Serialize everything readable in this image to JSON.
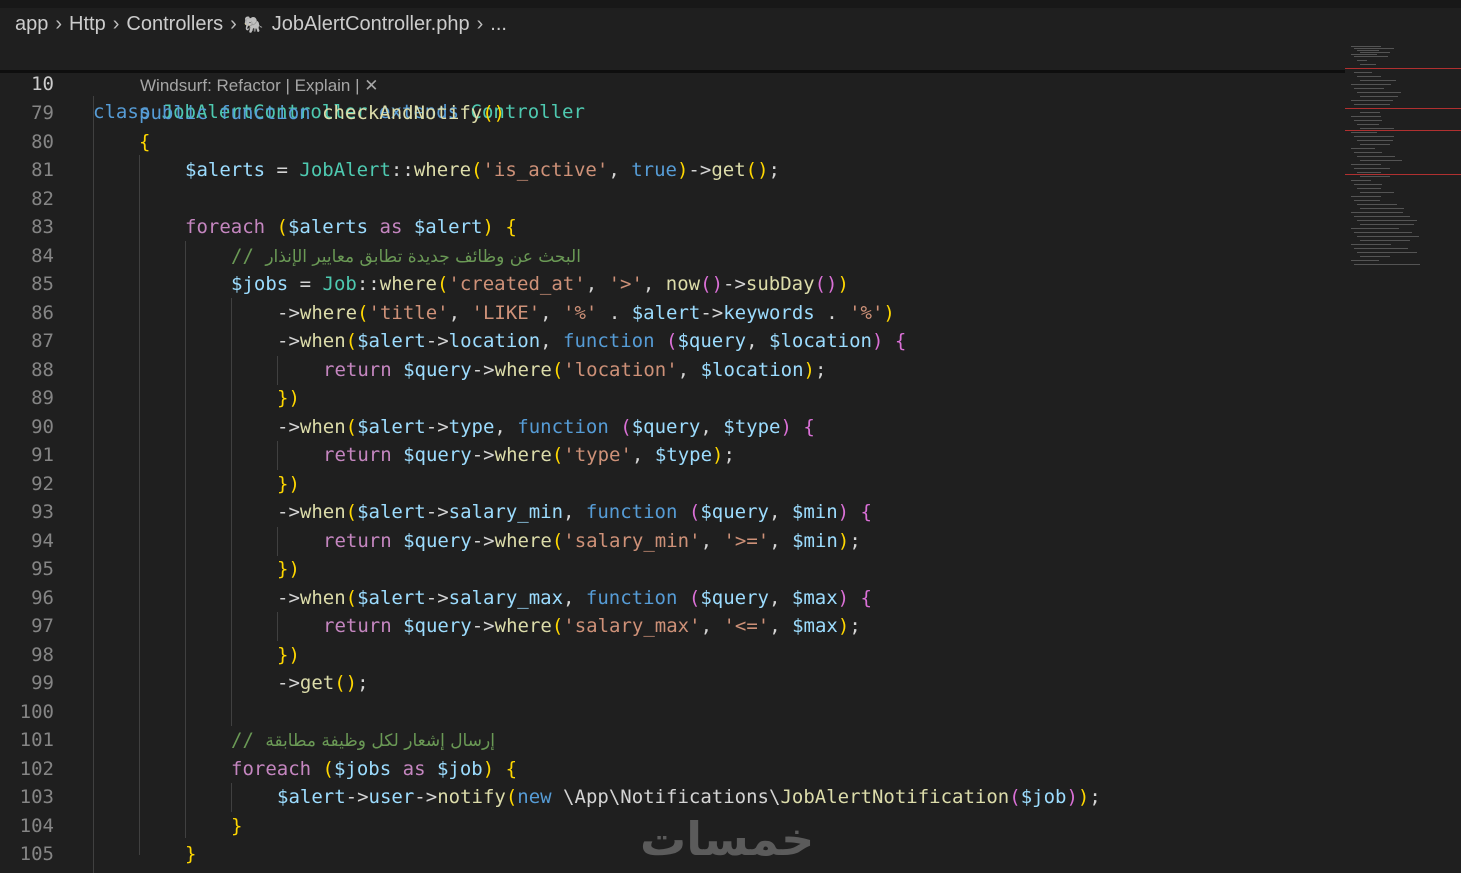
{
  "breadcrumb": {
    "items": [
      "app",
      "Http",
      "Controllers",
      "JobAlertController.php",
      "..."
    ]
  },
  "sticky_line": {
    "number": "10",
    "text": "class JobAlertController extends Controller"
  },
  "codelens": {
    "label": "Windsurf: Refactor | Explain | ✕"
  },
  "lines": [
    {
      "n": "79",
      "t": "public function checkAndNotify()"
    },
    {
      "n": "80",
      "t": "{"
    },
    {
      "n": "81",
      "t": "$alerts = JobAlert::where('is_active', true)->get();"
    },
    {
      "n": "82",
      "t": ""
    },
    {
      "n": "83",
      "t": "foreach ($alerts as $alert) {"
    },
    {
      "n": "84",
      "t": "// البحث عن وظائف جديدة تطابق معايير الإنذار"
    },
    {
      "n": "85",
      "t": "$jobs = Job::where('created_at', '>', now()->subDay())"
    },
    {
      "n": "86",
      "t": "->where('title', 'LIKE', '%' . $alert->keywords . '%')"
    },
    {
      "n": "87",
      "t": "->when($alert->location, function ($query, $location) {"
    },
    {
      "n": "88",
      "t": "return $query->where('location', $location);"
    },
    {
      "n": "89",
      "t": "})"
    },
    {
      "n": "90",
      "t": "->when($alert->type, function ($query, $type) {"
    },
    {
      "n": "91",
      "t": "return $query->where('type', $type);"
    },
    {
      "n": "92",
      "t": "})"
    },
    {
      "n": "93",
      "t": "->when($alert->salary_min, function ($query, $min) {"
    },
    {
      "n": "94",
      "t": "return $query->where('salary_min', '>=', $min);"
    },
    {
      "n": "95",
      "t": "})"
    },
    {
      "n": "96",
      "t": "->when($alert->salary_max, function ($query, $max) {"
    },
    {
      "n": "97",
      "t": "return $query->where('salary_max', '<=', $max);"
    },
    {
      "n": "98",
      "t": "})"
    },
    {
      "n": "99",
      "t": "->get();"
    },
    {
      "n": "100",
      "t": ""
    },
    {
      "n": "101",
      "t": "// إرسال إشعار لكل وظيفة مطابقة"
    },
    {
      "n": "102",
      "t": "foreach ($jobs as $job) {"
    },
    {
      "n": "103",
      "t": "$alert->user->notify(new \\App\\Notifications\\JobAlertNotification($job));"
    },
    {
      "n": "104",
      "t": "}"
    },
    {
      "n": "105",
      "t": "}"
    }
  ],
  "watermark": "خمسات",
  "colors": {
    "background": "#1f1f1f",
    "keyword": "#569cd6",
    "control": "#c586c0",
    "class": "#4ec9b0",
    "function": "#dcdcaa",
    "variable": "#9cdcfe",
    "string": "#ce9178",
    "comment": "#6a9955"
  }
}
